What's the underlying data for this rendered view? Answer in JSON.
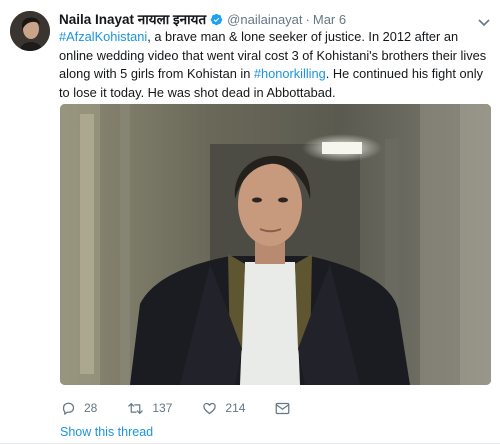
{
  "author": {
    "display_name": "Naila Inayat नायला इनायत",
    "handle": "@nailainayat",
    "separator": "·",
    "timestamp": "Mar 6",
    "verified": true
  },
  "tweet": {
    "segments": [
      {
        "text": "#AfzalKohistani",
        "type": "hashtag"
      },
      {
        "text": ", a brave man & lone seeker of justice. In 2012 after an online wedding video that went viral cost 3 of Kohistani's brothers their lives along with 5 girls from Kohistan in ",
        "type": "text"
      },
      {
        "text": "#honorkilling",
        "type": "hashtag"
      },
      {
        "text": ". He continued his fight only to lose it today. He was shot dead in Abbottabad.",
        "type": "text"
      }
    ]
  },
  "actions": {
    "replies": "28",
    "retweets": "137",
    "likes": "214"
  },
  "show_thread_label": "Show this thread",
  "colors": {
    "link": "#1b95e0",
    "muted": "#657786",
    "text": "#14171a",
    "verified": "#1da1f2"
  },
  "icons": {
    "verified": "verified-badge-icon",
    "caret": "chevron-down-icon",
    "reply": "reply-icon",
    "retweet": "retweet-icon",
    "like": "heart-icon",
    "message": "direct-message-icon"
  }
}
